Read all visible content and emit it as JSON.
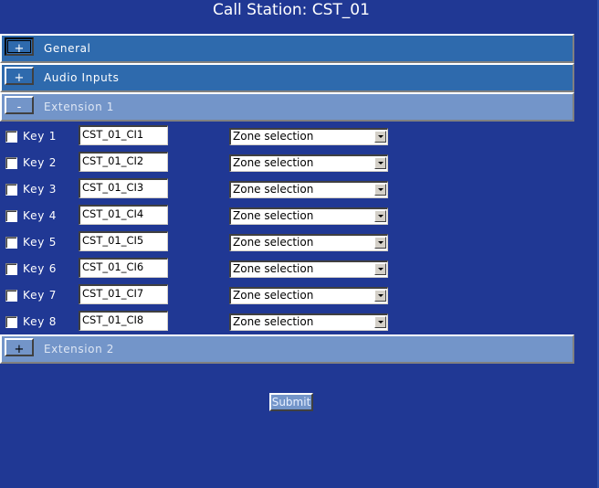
{
  "title": "Call Station: CST_01",
  "sections": [
    {
      "toggle": "+",
      "label": "General",
      "expanded": false
    },
    {
      "toggle": "+",
      "label": "Audio Inputs",
      "expanded": false
    },
    {
      "toggle": "-",
      "label": "Extension  1",
      "expanded": true
    },
    {
      "toggle": "+",
      "label": "Extension  2",
      "expanded": false
    }
  ],
  "keys": [
    {
      "label": "Key 1",
      "checked": false,
      "value": "CST_01_CI1",
      "zone": "Zone selection"
    },
    {
      "label": "Key 2",
      "checked": false,
      "value": "CST_01_CI2",
      "zone": "Zone selection"
    },
    {
      "label": "Key 3",
      "checked": false,
      "value": "CST_01_CI3",
      "zone": "Zone selection"
    },
    {
      "label": "Key 4",
      "checked": false,
      "value": "CST_01_CI4",
      "zone": "Zone selection"
    },
    {
      "label": "Key 5",
      "checked": false,
      "value": "CST_01_CI5",
      "zone": "Zone selection"
    },
    {
      "label": "Key 6",
      "checked": false,
      "value": "CST_01_CI6",
      "zone": "Zone selection"
    },
    {
      "label": "Key 7",
      "checked": false,
      "value": "CST_01_CI7",
      "zone": "Zone selection"
    },
    {
      "label": "Key 8",
      "checked": false,
      "value": "CST_01_CI8",
      "zone": "Zone selection"
    }
  ],
  "submit_label": "Submit"
}
